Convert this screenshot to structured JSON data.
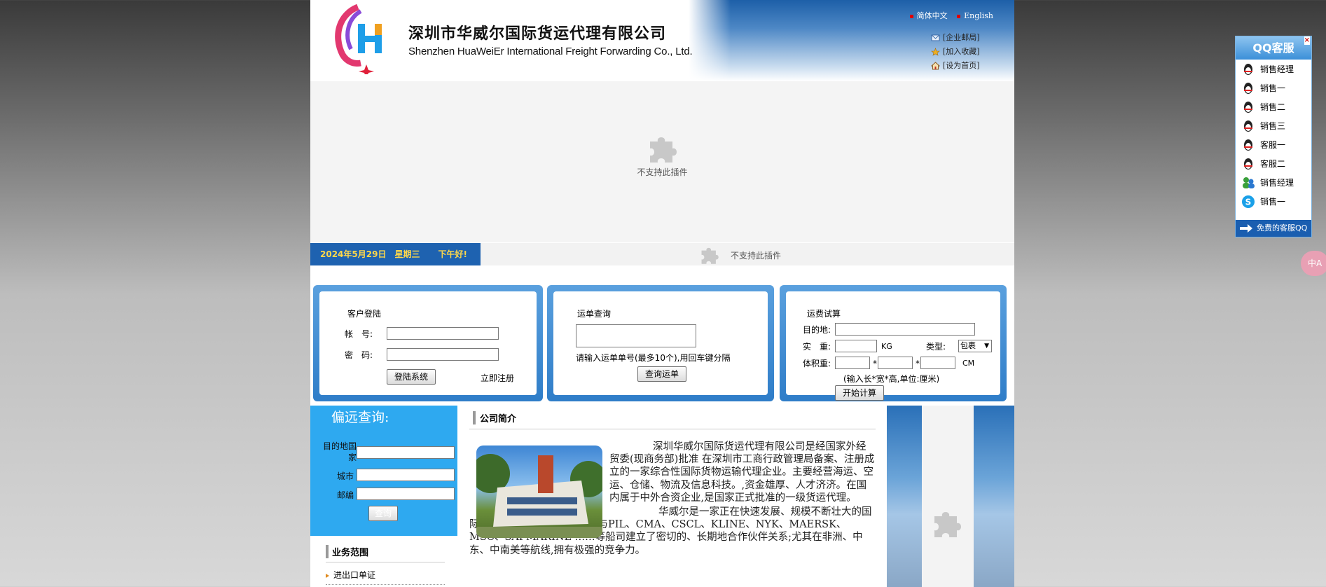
{
  "header": {
    "company_cn": "深圳市华威尔国际货运代理有限公司",
    "company_en": "Shenzhen HuaWeiEr International Freight Forwarding Co., Ltd.",
    "lang_cn": "简体中文",
    "lang_en": "English",
    "links": [
      "[企业邮局]",
      "[加入收藏]",
      "[设为首页]"
    ]
  },
  "plugin": {
    "unsupported": "不支持此插件"
  },
  "datebar": {
    "date": "2024年5月29日",
    "weekday": "星期三",
    "greeting": "下午好!",
    "plugin_msg": "不支持此插件"
  },
  "login": {
    "title": "客户登陆",
    "account_label": "帐　号:",
    "password_label": "密　码:",
    "login_button": "登陆系统",
    "register_link": "立即注册"
  },
  "tracking": {
    "title": "运单查询",
    "hint": "请输入运单单号(最多10个),用回车键分隔",
    "query_button": "查询运单"
  },
  "calc": {
    "title": "运费试算",
    "dest_label": "目的地:",
    "weight_label": "实　重:",
    "weight_unit": "KG",
    "type_label": "类型:",
    "type_value": "包裹",
    "volume_label": "体积重:",
    "star": "*",
    "cm_unit": "CM",
    "volume_hint": "(输入长*宽*高,单位:厘米)",
    "calc_button": "开始计算"
  },
  "remote": {
    "title": "偏远查询:",
    "country_label": "目的地国家",
    "city_label": "城市",
    "zip_label": "邮编",
    "query_button": "查询"
  },
  "business": {
    "title": "业务范围",
    "items": [
      "进出口单证"
    ]
  },
  "intro": {
    "title": "公司简介",
    "p1": "深圳华威尔国际货运代理有限公司是经国家外经贸委(现商务部)批准 在深圳市工商行政管理局备案、注册成立的一家综合性国际货物运输代理企业。主要经营海运、空运、仓储、物流及信息科技。,资金雄厚、人才济济。在国内属于中外合资企业,是国家正式批准的一级货运代理。",
    "p2": "华威尔是一家正在快速发展、规模不断壮大的国际物流公司;公司自成立至今,与PIL、CMA、CSCL、KLINE、NYK、MAERSK、MSC、SAFMARINE ……等船司建立了密切的、长期地合作伙伴关系;尤其在非洲、中东、中南美等航线,拥有极强的竞争力。"
  },
  "qq": {
    "title": "QQ客服",
    "close": "×",
    "items": [
      "销售经理",
      "销售一",
      "销售二",
      "销售三",
      "客服一",
      "客服二",
      "销售经理",
      "销售一"
    ],
    "footer": "免费的客服QQ"
  },
  "side_button": "中A",
  "colors": {
    "brand_blue": "#1e62b0",
    "date_text": "#ffd84a",
    "panel_blue": "#2f7dc8",
    "left_blue": "#2ea9f0"
  }
}
